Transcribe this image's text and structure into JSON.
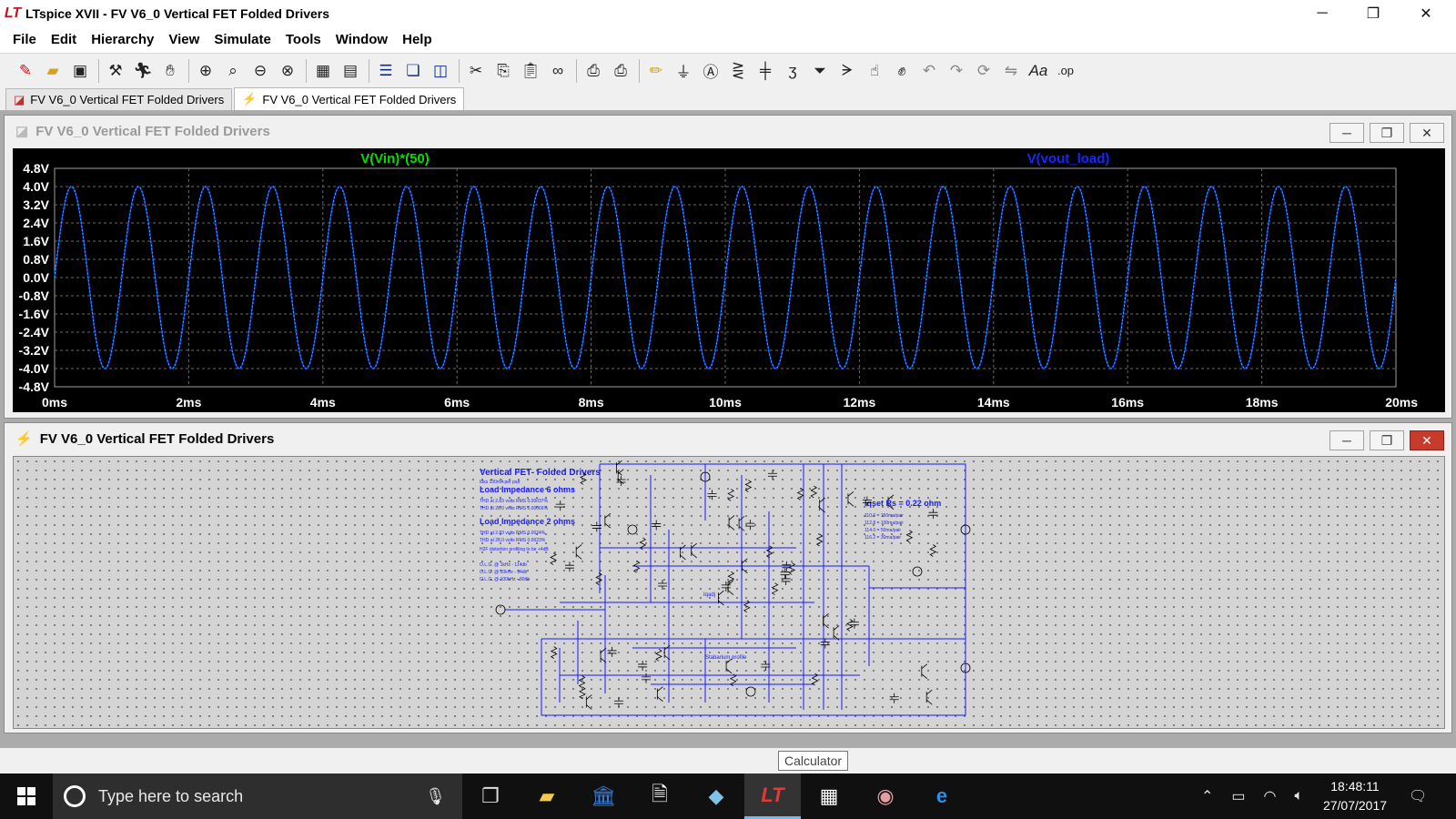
{
  "window": {
    "title": "LTspice XVII - FV V6_0 Vertical FET Folded Drivers",
    "minimize": "─",
    "maximize": "❐",
    "close": "✕"
  },
  "menu": [
    "File",
    "Edit",
    "Hierarchy",
    "View",
    "Simulate",
    "Tools",
    "Window",
    "Help"
  ],
  "toolbar_icons": [
    "new-schematic-icon",
    "open-icon",
    "save-icon",
    "control-panel-icon",
    "run-icon",
    "halt-icon",
    "zoom-in-icon",
    "zoom-rect-icon",
    "zoom-out-icon",
    "zoom-cancel-icon",
    "autorange-icon",
    "grid-icon",
    "tile-horizontal-icon",
    "cascade-icon",
    "tile-vertical-icon",
    "cut-icon",
    "copy-icon",
    "paste-icon",
    "find-icon",
    "print-setup-icon",
    "print-icon",
    "draw-wire-icon",
    "ground-icon",
    "label-net-icon",
    "resistor-icon",
    "capacitor-icon",
    "inductor-icon",
    "diode-icon",
    "component-icon",
    "drag-icon",
    "move-icon",
    "undo-icon",
    "redo-icon",
    "rotate-icon",
    "mirror-icon",
    "text-icon",
    "spice-directive-icon"
  ],
  "tabs": [
    {
      "label": "FV V6_0 Vertical FET Folded Drivers",
      "icon": "waveform-icon",
      "active": false
    },
    {
      "label": "FV V6_0 Vertical FET Folded Drivers",
      "icon": "schematic-icon",
      "active": true
    }
  ],
  "waveform_window": {
    "title": "FV V6_0 Vertical FET Folded Drivers",
    "active": false
  },
  "schematic_window": {
    "title": "FV V6_0 Vertical FET Folded Drivers",
    "active": true,
    "notes": {
      "heading": "Vertical FET- Folded Drivers",
      "bias": "Idss 100mA per pair",
      "load6": "Load Impedance 6 ohms",
      "thd6a": "THD at 2.83 volts RMS 0.00037%",
      "thd6b": "THD at 28.0 volts RMS 0.00066%",
      "load2": "Load Impedance 2 ohms",
      "thd2a": "THD at 2.83 volts RMS 0.0024%",
      "thd2b": "THD at 28.0 volts RMS 0.0023%",
      "h2": "H2F distortion profiling to be +4dB",
      "olg1": "O.L.G. @   1kHz -  114db",
      "olg2": "O.L.G. @   20kHz -  94db",
      "olg3": "O.L.G. @ 100kHz -  80db",
      "iqset": "Iqset Rs = 0.22 ohm",
      "iq1": "110.0 = 150ma/pair",
      "iq2": "112.8 = 100ma/pair",
      "iq3": "114.0 =  50ma/pair",
      "iq4": "116.2 =  30ma/pair",
      "iqadj": "Iqadj",
      "stab": "Stabarium profile"
    }
  },
  "chart_data": {
    "type": "line",
    "series": [
      {
        "name": "V(Vin)*(50)",
        "color": "#00e000",
        "amplitude": 4.0,
        "frequency_hz": 1000
      },
      {
        "name": "V(vout_load)",
        "color": "#1428ff",
        "amplitude": 4.0,
        "frequency_hz": 1000
      }
    ],
    "trace_color": "#17d4d4",
    "x_range_ms": [
      0,
      20
    ],
    "y_range": [
      -4.8,
      4.8
    ],
    "x_ticks": [
      "0ms",
      "2ms",
      "4ms",
      "6ms",
      "8ms",
      "10ms",
      "12ms",
      "14ms",
      "16ms",
      "18ms",
      "20ms"
    ],
    "y_ticks": [
      "4.8V",
      "4.0V",
      "3.2V",
      "2.4V",
      "1.6V",
      "0.8V",
      "0.0V",
      "-0.8V",
      "-1.6V",
      "-2.4V",
      "-3.2V",
      "-4.0V",
      "-4.8V"
    ],
    "grid": true
  },
  "tooltip": "Calculator",
  "taskbar": {
    "search_placeholder": "Type here to search",
    "time": "18:48:11",
    "date": "27/07/2017"
  }
}
